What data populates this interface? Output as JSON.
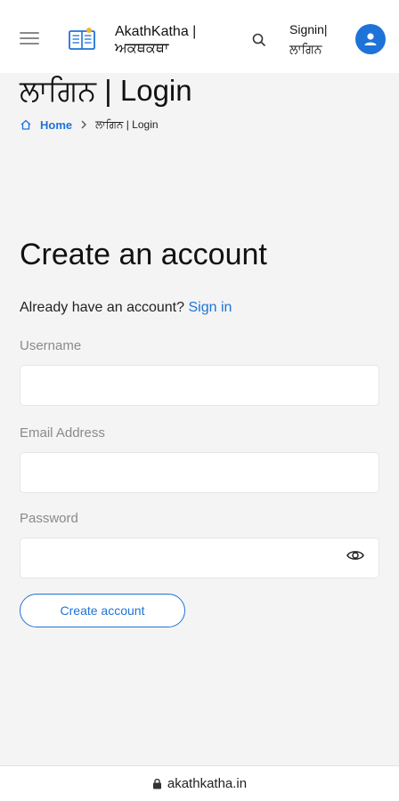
{
  "header": {
    "site_title": "AkathKatha | ਅਕਥਕਥਾ",
    "signin_label": "Signin| ਲਾਗਿਨ",
    "icons": [
      "menu-icon",
      "book-logo-icon",
      "search-icon",
      "user-icon"
    ]
  },
  "page": {
    "title": "ਲਾਗਿਨ | Login"
  },
  "breadcrumb": {
    "home": "Home",
    "current": "ਲਾਗਿਨ | Login"
  },
  "form": {
    "heading": "Create an account",
    "already_text": "Already have an account?",
    "signin_link": "Sign in",
    "username_label": "Username",
    "username_value": "",
    "email_label": "Email Address",
    "email_value": "",
    "password_label": "Password",
    "password_value": "",
    "submit_label": "Create account"
  },
  "browser": {
    "url": "akathkatha.in"
  },
  "colors": {
    "accent": "#1e73d8",
    "background": "#f4f4f5"
  }
}
